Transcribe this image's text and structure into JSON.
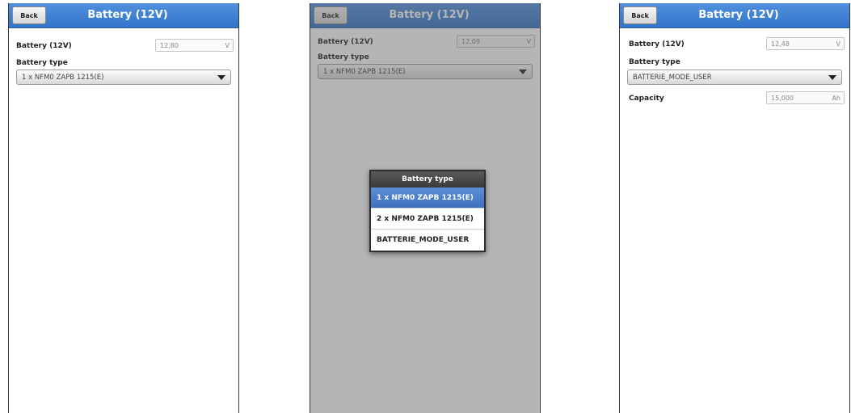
{
  "screens": [
    {
      "back_label": "Back",
      "title": "Battery (12V)",
      "voltage_label": "Battery (12V)",
      "voltage_value": "12,80",
      "voltage_unit": "V",
      "type_label": "Battery type",
      "type_value": "1 x NFM0 ZAPB 1215(E)"
    },
    {
      "back_label": "Back",
      "title": "Battery (12V)",
      "voltage_label": "Battery (12V)",
      "voltage_value": "12,09",
      "voltage_unit": "V",
      "type_label": "Battery type",
      "type_value": "1 x NFM0 ZAPB 1215(E)",
      "dialog": {
        "title": "Battery type",
        "options": [
          "1 x NFM0 ZAPB 1215(E)",
          "2 x NFM0 ZAPB 1215(E)",
          "BATTERIE_MODE_USER"
        ],
        "selected_index": 0
      }
    },
    {
      "back_label": "Back",
      "title": "Battery (12V)",
      "voltage_label": "Battery (12V)",
      "voltage_value": "12,48",
      "voltage_unit": "V",
      "type_label": "Battery type",
      "type_value": "BATTERIE_MODE_USER",
      "capacity_label": "Capacity",
      "capacity_value": "15,000",
      "capacity_unit": "Ah"
    }
  ],
  "colors": {
    "header_blue": "#3f82d4",
    "selected_option": "#4a7fcc",
    "overlay": "#8a8a8a"
  }
}
